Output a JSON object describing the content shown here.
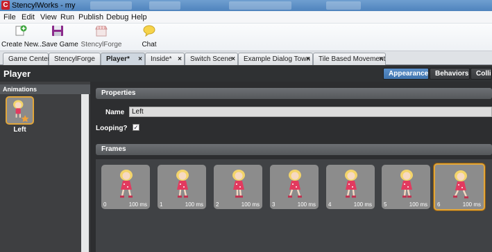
{
  "window": {
    "title": "StencylWorks - my",
    "app_icon_letter": "C"
  },
  "menu": [
    "File",
    "Edit",
    "View",
    "Run",
    "Publish",
    "Debug",
    "Help"
  ],
  "toolbar": {
    "create_new": "Create New...",
    "save_game": "Save Game",
    "stencylforge": "StencylForge",
    "chat": "Chat"
  },
  "tabs": [
    "Game Center",
    "StencylForge",
    "Player*",
    "Inside*",
    "Switch Scene",
    "Example Dialog Town",
    "Tile Based Movement"
  ],
  "editor": {
    "title": "Player",
    "view_tabs": [
      "Appearance",
      "Behaviors",
      "Collis"
    ]
  },
  "animations": {
    "header": "Animations",
    "items": [
      {
        "label": "Left"
      }
    ]
  },
  "properties": {
    "header": "Properties",
    "name_label": "Name",
    "name_value": "Left",
    "looping_label": "Looping?",
    "looping_checked": true,
    "checkmark": "✓"
  },
  "frames": {
    "header": "Frames",
    "items": [
      {
        "index": "0",
        "duration": "100 ms"
      },
      {
        "index": "1",
        "duration": "100 ms"
      },
      {
        "index": "2",
        "duration": "100 ms"
      },
      {
        "index": "3",
        "duration": "100 ms"
      },
      {
        "index": "4",
        "duration": "100 ms"
      },
      {
        "index": "5",
        "duration": "100 ms"
      },
      {
        "index": "6",
        "duration": "100 ms"
      }
    ],
    "selected_index": 6
  },
  "colors": {
    "accent": "#4f83bd",
    "selection": "#e2a63a",
    "dress": "#e23a5f"
  }
}
